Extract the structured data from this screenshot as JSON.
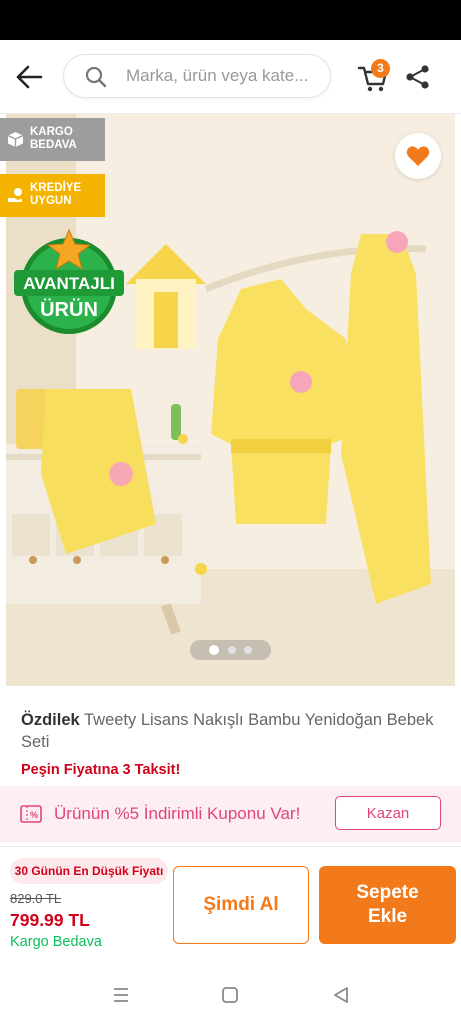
{
  "search": {
    "placeholder": "Marka, ürün veya kate..."
  },
  "header": {
    "cart_count": "3"
  },
  "badges": {
    "cargo": [
      "KARGO",
      "BEDAVA"
    ],
    "credit": [
      "KREDİYE",
      "UYGUN"
    ],
    "avantaj": [
      "AVANTAJLI",
      "ÜRÜN"
    ]
  },
  "gallery": {
    "image_count": 3,
    "active_index": 0
  },
  "product": {
    "brand": "Özdilek",
    "name": "Tweety Lisans Nakışlı Bambu Yenidoğan Bebek Seti",
    "installment": "Peşin Fiyatına 3 Taksit!"
  },
  "coupon": {
    "text": "Ürünün %5 İndirimli Kuponu Var!",
    "button": "Kazan"
  },
  "price": {
    "lowest_badge": "30 Günün En Düşük Fiyatı",
    "old": "829.0 TL",
    "new": "799.99 TL",
    "shipping": "Kargo Bedava"
  },
  "actions": {
    "buy_now": "Şimdi Al",
    "add_to_cart": "Sepete Ekle"
  },
  "colors": {
    "accent": "#f27a1a",
    "price": "#d0021b",
    "coupon": "#e0457b",
    "shipping": "#0bc15c"
  }
}
